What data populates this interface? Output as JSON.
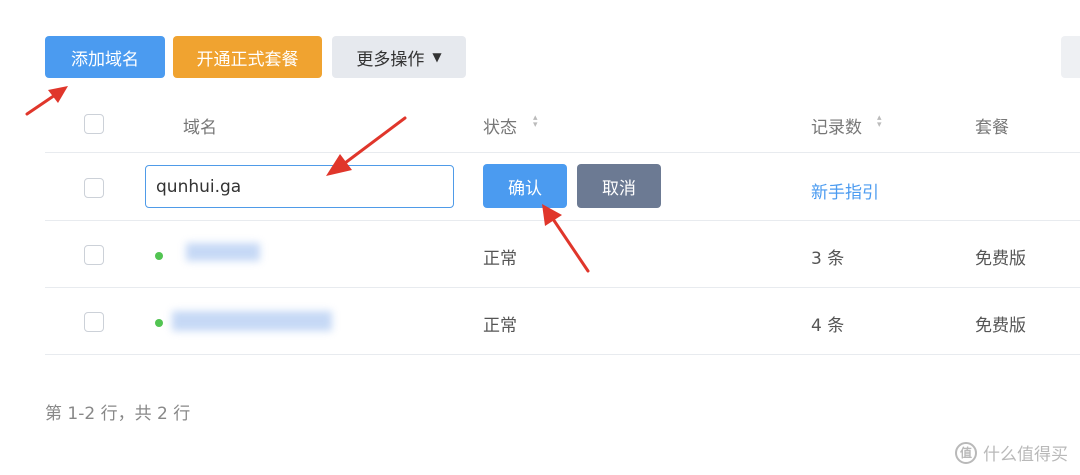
{
  "toolbar": {
    "add_domain": "添加域名",
    "upgrade_plan": "开通正式套餐",
    "more_actions": "更多操作",
    "more_actions_caret": "▼"
  },
  "table": {
    "headers": {
      "domain": "域名",
      "status": "状态",
      "records": "记录数",
      "plan": "套餐"
    },
    "sort_glyph": "▴▾",
    "new_row": {
      "domain_input_value": "qunhui.ga",
      "confirm": "确认",
      "cancel": "取消",
      "guide_link": "新手指引"
    },
    "rows": [
      {
        "status": "正常",
        "records": "3 条",
        "plan": "免费版"
      },
      {
        "status": "正常",
        "records": "4 条",
        "plan": "免费版"
      }
    ]
  },
  "footer": {
    "summary": "第 1-2 行，共 2 行"
  },
  "watermark": {
    "icon_text": "值",
    "text": "什么值得买"
  },
  "colors": {
    "primary": "#4b9bf0",
    "warning": "#f0a330",
    "cancel": "#6c7a93",
    "status_ok": "#52c452",
    "annotation": "#e0362b"
  }
}
